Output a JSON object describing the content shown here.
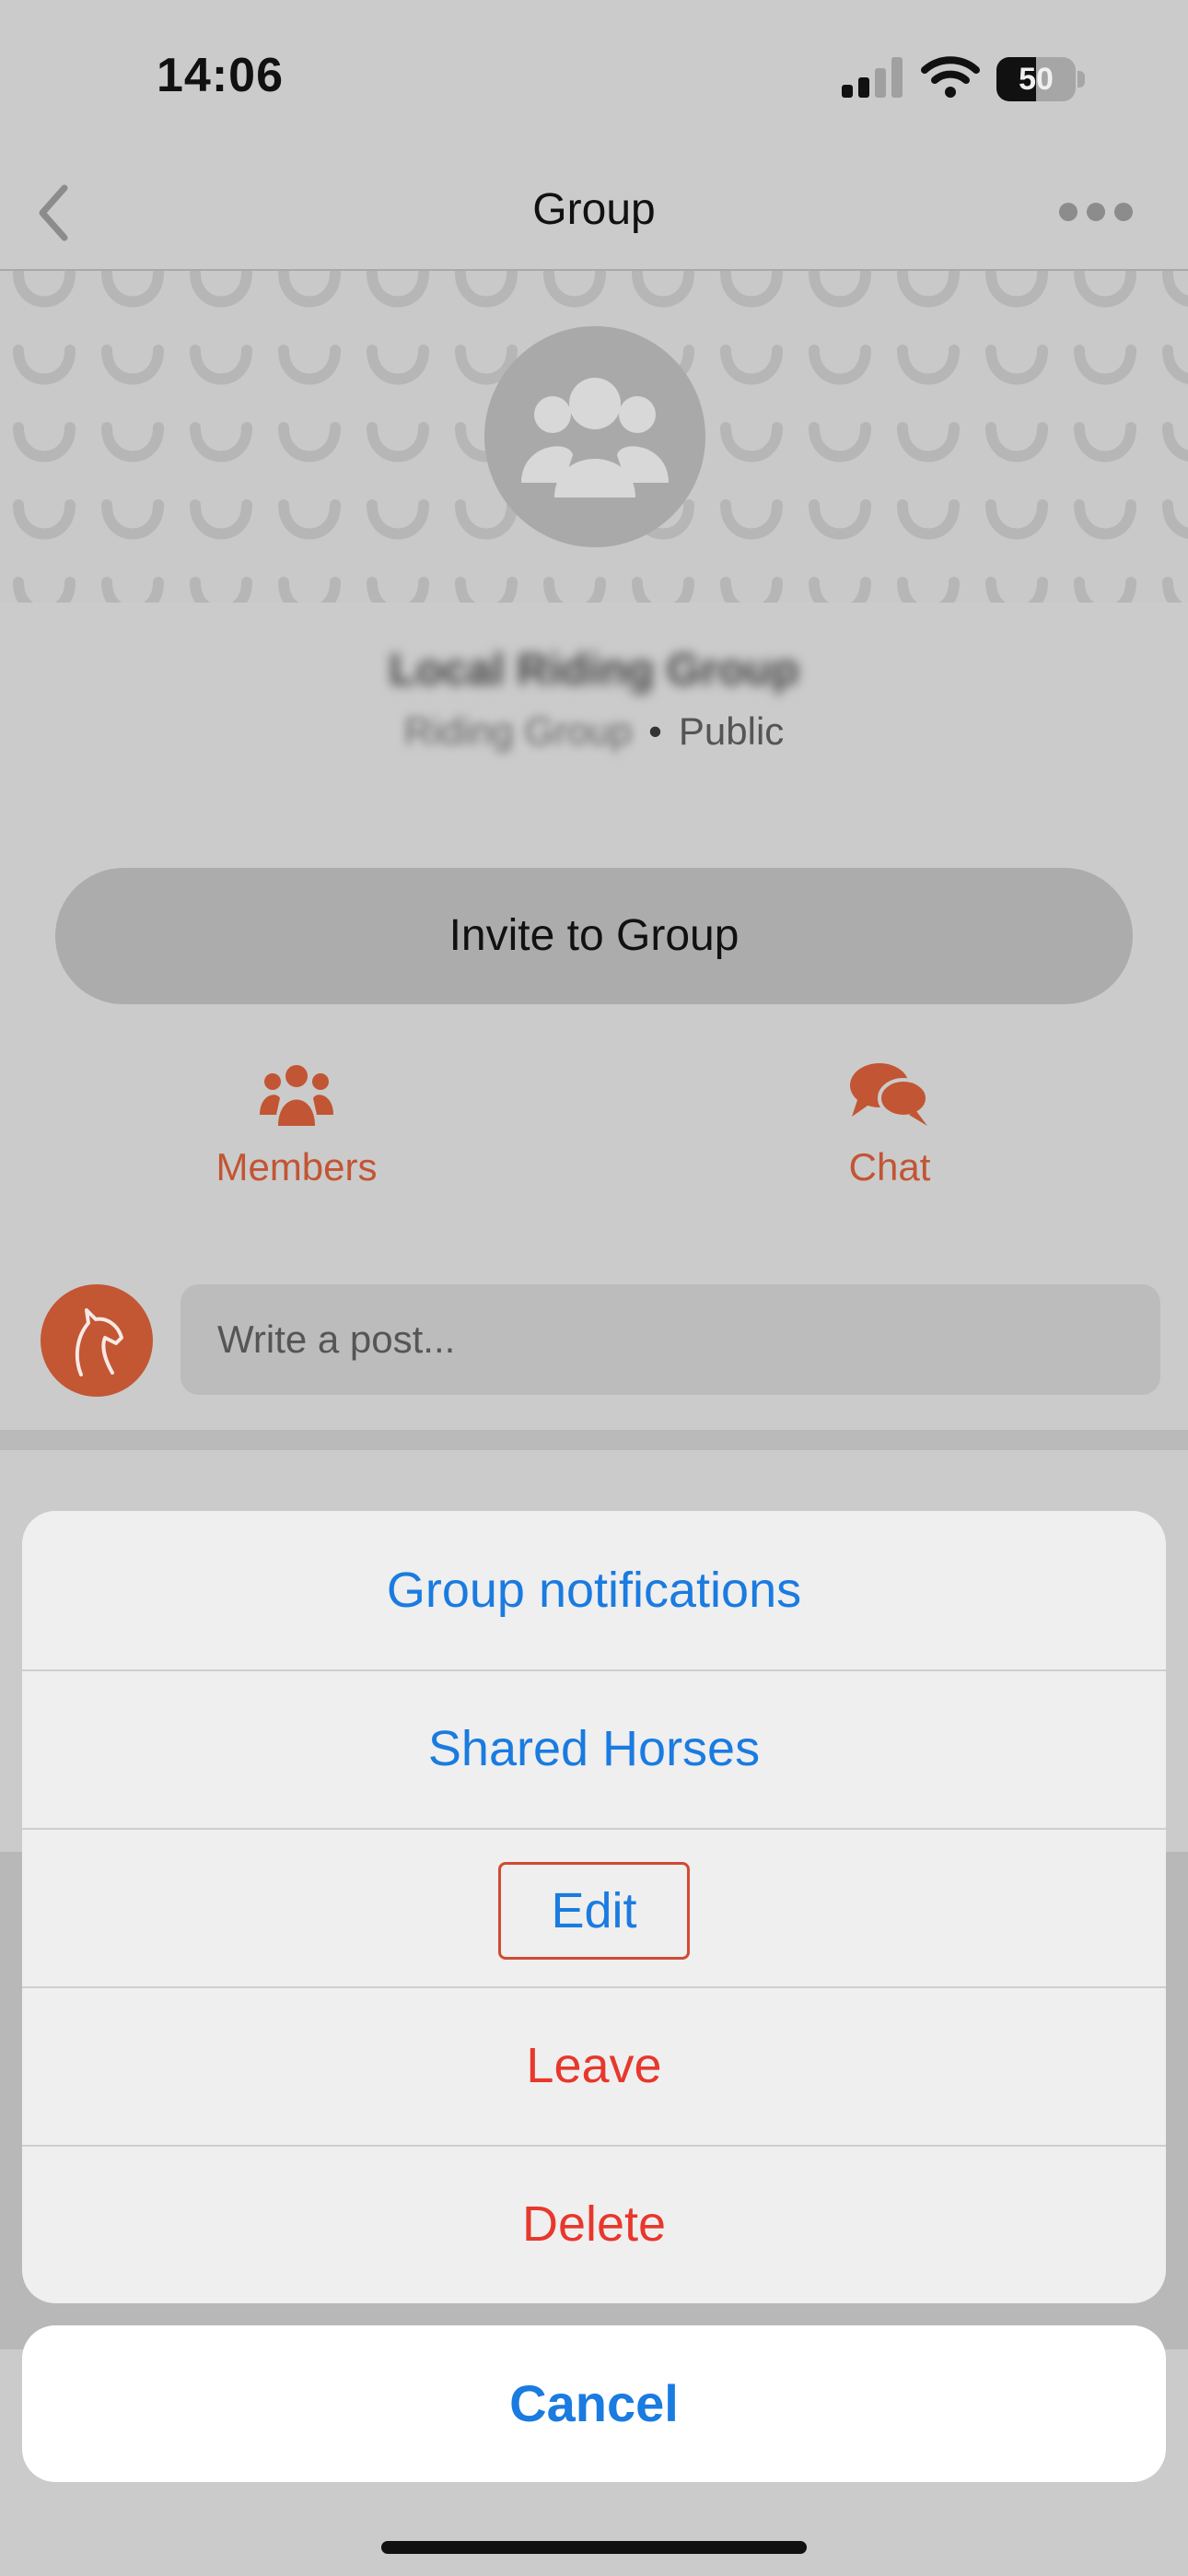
{
  "status_bar": {
    "time": "14:06",
    "battery": "50",
    "battery_level": 0.5
  },
  "nav": {
    "title": "Group"
  },
  "group": {
    "name": "Local Riding Group",
    "type": "Riding Group",
    "visibility": "Public"
  },
  "actions": {
    "invite_label": "Invite to Group",
    "members_label": "Members",
    "chat_label": "Chat"
  },
  "post": {
    "placeholder": "Write a post..."
  },
  "action_sheet": {
    "items": [
      {
        "label": "Group notifications"
      },
      {
        "label": "Shared Horses"
      },
      {
        "label": "Edit"
      },
      {
        "label": "Leave"
      },
      {
        "label": "Delete"
      }
    ],
    "cancel_label": "Cancel"
  },
  "colors": {
    "accent": "#c25533",
    "ios_blue": "#1a7be0",
    "destructive": "#e8372c"
  },
  "icons": [
    "back-chevron-icon",
    "more-dots-icon",
    "group-icon",
    "members-icon",
    "chat-icon",
    "horse-avatar-icon",
    "horseshoe-icon"
  ]
}
